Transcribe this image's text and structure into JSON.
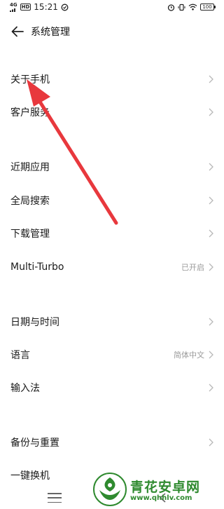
{
  "status_bar": {
    "network": "4G",
    "hd": "HD",
    "time": "15:21",
    "battery": "100"
  },
  "header": {
    "title": "系统管理"
  },
  "settings": {
    "about_phone": "关于手机",
    "customer_service": "客户服务",
    "recent_apps": "近期应用",
    "global_search": "全局搜索",
    "download_manager": "下载管理",
    "multi_turbo": "Multi-Turbo",
    "multi_turbo_value": "已开启",
    "date_time": "日期与时间",
    "language": "语言",
    "language_value": "简体中文",
    "input_method": "输入法",
    "backup_reset": "备份与重置",
    "one_key_switch": "一键换机"
  },
  "watermark": {
    "name": "青花安卓网",
    "url": "www.qhhlv.com"
  },
  "colors": {
    "annotation_arrow": "#e8383d",
    "watermark_green": "#2f8a2f"
  }
}
